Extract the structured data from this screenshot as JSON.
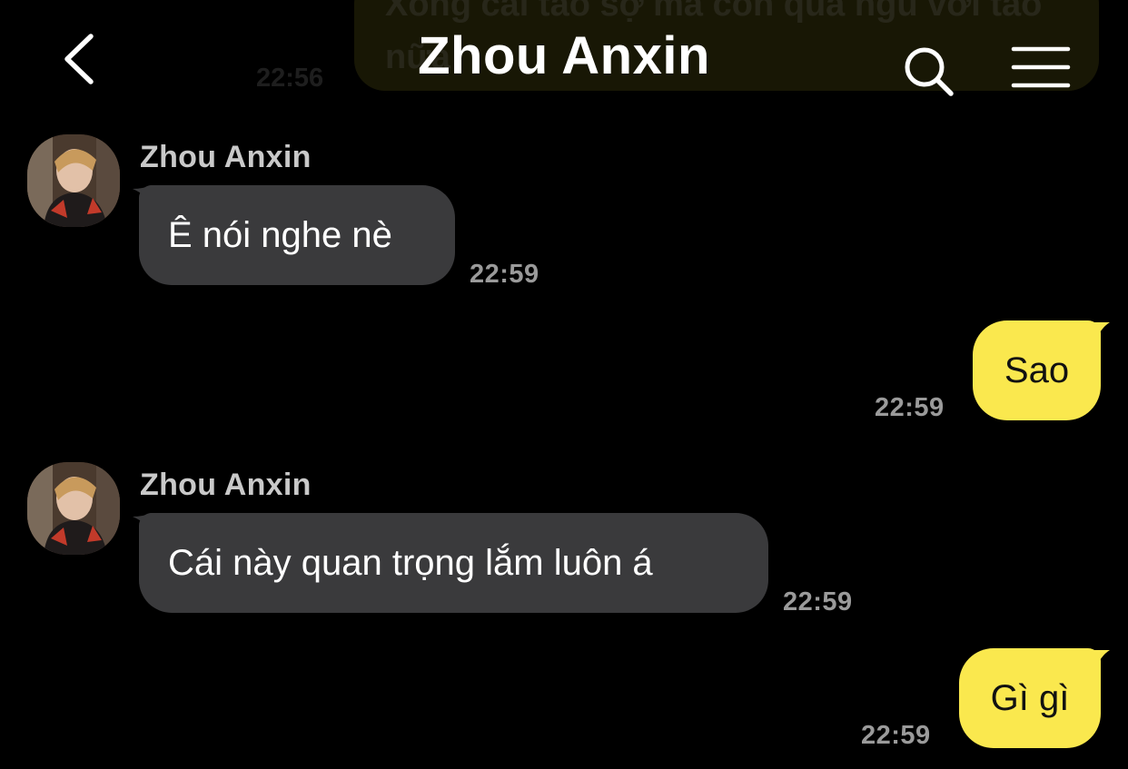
{
  "header": {
    "title": "Zhou Anxin",
    "back_icon": "chevron-left-icon",
    "search_icon": "search-icon",
    "menu_icon": "menu-icon"
  },
  "previous_message": {
    "text": "Xong cái tao sợ mà còn quá ngu với tao nữa",
    "time": "22:56"
  },
  "messages": [
    {
      "direction": "incoming",
      "sender": "Zhou Anxin",
      "text": "Ê nói nghe nè",
      "time": "22:59"
    },
    {
      "direction": "outgoing",
      "text": "Sao",
      "time": "22:59"
    },
    {
      "direction": "incoming",
      "sender": "Zhou Anxin",
      "text": "Cái này quan trọng lắm luôn á",
      "time": "22:59"
    },
    {
      "direction": "outgoing",
      "text": "Gì gì",
      "time": "22:59"
    }
  ],
  "colors": {
    "background": "#000000",
    "incoming_bubble": "#3a3a3c",
    "outgoing_bubble": "#fae84e",
    "timestamp": "#9a9a9a",
    "sender_name": "#c9c9c9"
  }
}
